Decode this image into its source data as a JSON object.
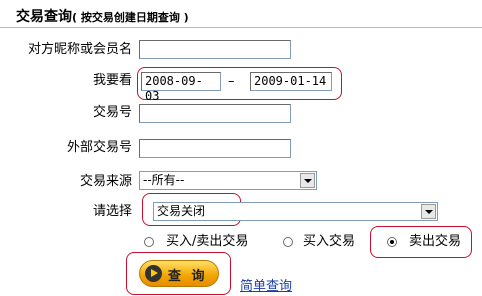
{
  "header": {
    "title": "交易查询",
    "subtitle": "( 按交易创建日期查询 )"
  },
  "form": {
    "counterparty": {
      "label": "对方昵称或会员名",
      "value": ""
    },
    "period": {
      "label": "我要看",
      "start": "2008-09-03",
      "separator": "–",
      "end": "2009-01-14"
    },
    "trade_no": {
      "label": "交易号",
      "value": ""
    },
    "external_trade_no": {
      "label": "外部交易号",
      "value": ""
    },
    "source": {
      "label": "交易来源",
      "selected": "--所有--"
    },
    "status": {
      "label": "请选择",
      "selected": "交易关闭"
    },
    "trade_type": {
      "options": [
        "买入/卖出交易",
        "买入交易",
        "卖出交易"
      ],
      "selected_index": 2
    }
  },
  "actions": {
    "search_label": "查 询",
    "simple_search_label": "简单查询"
  },
  "colors": {
    "highlight_ring": "#c8102e",
    "link": "#1b3fa8",
    "button": "#f3a400"
  }
}
